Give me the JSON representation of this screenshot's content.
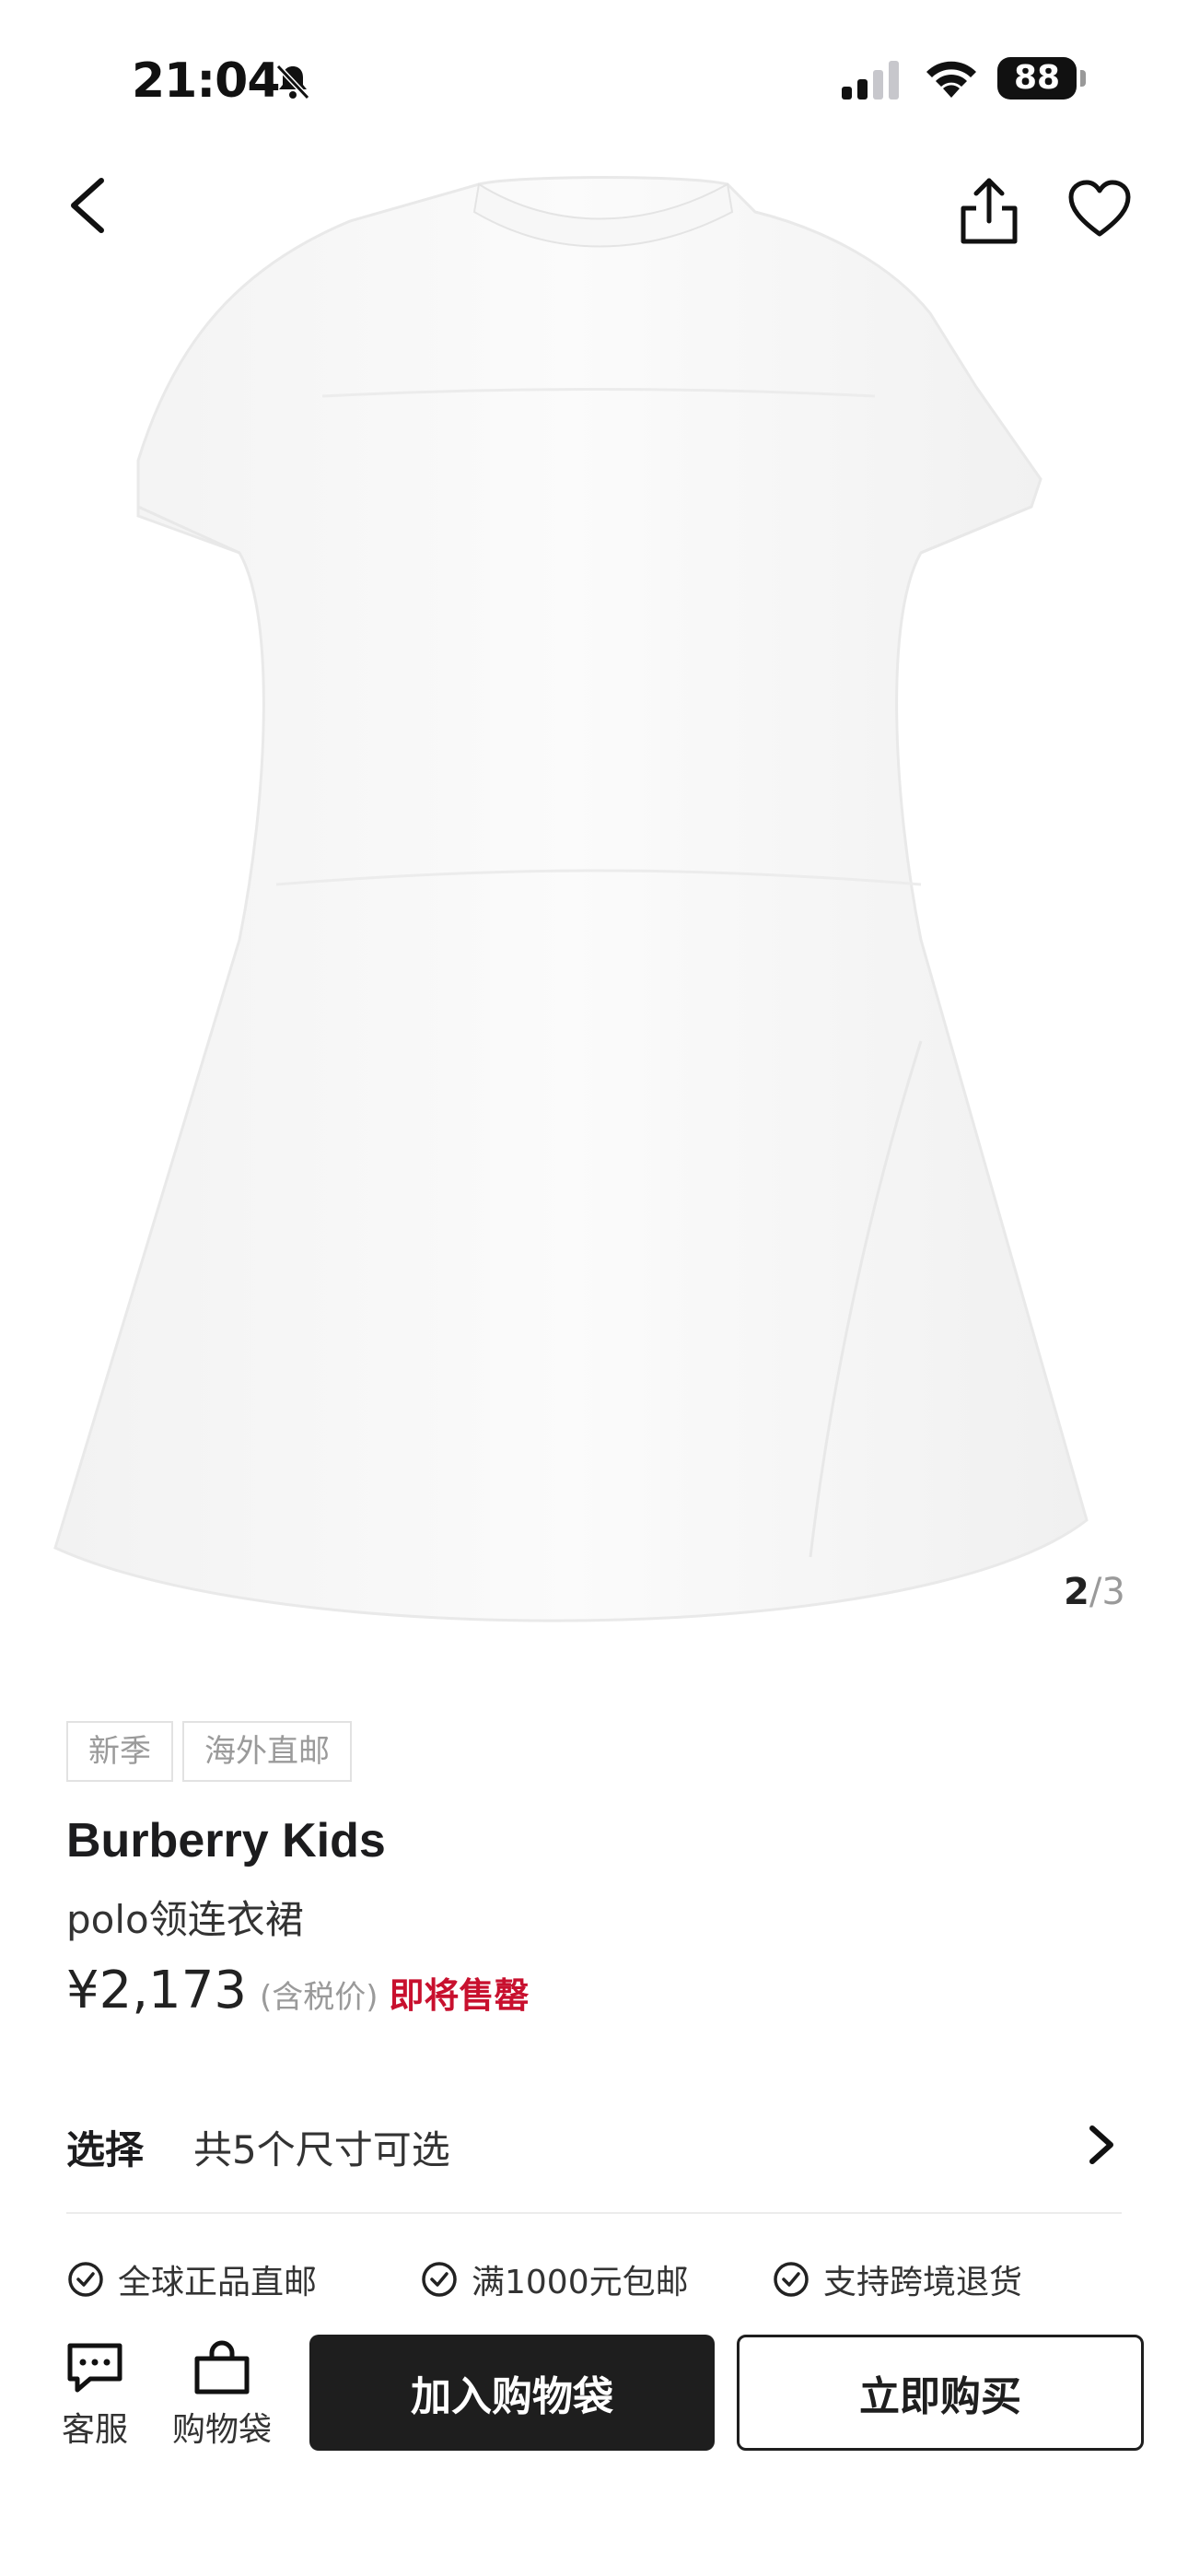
{
  "status_bar": {
    "time": "21:04",
    "battery": "88"
  },
  "product": {
    "image_index": "2",
    "image_separator": "/",
    "image_total": "3",
    "tags": [
      "新季",
      "海外直邮"
    ],
    "brand": "Burberry Kids",
    "name": "polo领连衣裙",
    "price": "¥2,173",
    "tax_note": "(含税价)",
    "stock_status": "即将售罄"
  },
  "size_selector": {
    "label": "选择",
    "value": "共5个尺寸可选"
  },
  "guarantees": [
    "全球正品直邮",
    "满1000元包邮",
    "支持跨境退货"
  ],
  "bottom_bar": {
    "service_label": "客服",
    "bag_label": "购物袋",
    "add_to_bag": "加入购物袋",
    "buy_now": "立即购买"
  },
  "colors": {
    "accent_red": "#c8102e",
    "button_dark": "#1e1e1e"
  }
}
